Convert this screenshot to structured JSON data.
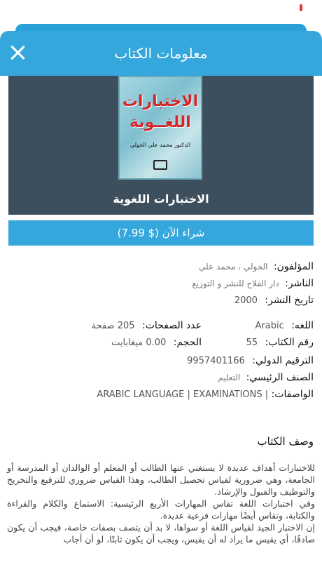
{
  "header": {
    "title": "معلومات الكتاب"
  },
  "book": {
    "cover_title_line1": "الاختبارات",
    "cover_title_line2": "اللغــوية",
    "cover_author": "الدكتور محمد علي الخولي",
    "title": "الاختبارات اللغوية"
  },
  "buy": {
    "label": "شراء الآن ($ 7.99)"
  },
  "meta": {
    "author_label": "المؤلفون:",
    "author_value": "الخولي ، محمد علي",
    "publisher_label": "الناشر:",
    "publisher_value": "دار الفلاح للنشر و التوزيع",
    "date_label": "تاريخ النشر:",
    "date_value": "2000",
    "pages_label": "عدد الصفحات:",
    "pages_value": "205 صفحة",
    "language_label": "اللغه:",
    "language_value": "Arabic",
    "size_label": "الحجم:",
    "size_value": "0.00 ميغابايت",
    "book_number_label": "رقم الكتاب:",
    "book_number_value": "55",
    "isbn_label": "الترقيم الدولي:",
    "isbn_value": "9957401166",
    "category_label": "الصنف الرئيسي:",
    "category_value": "التعليم",
    "tags_label": "الواصفات:",
    "tags_value": "ARABIC LANGUAGE | EXAMINATIONS |"
  },
  "description": {
    "title": "وصف الكتاب",
    "p1": "للاختبارات أهداف عديدة لا يستغني عنها الطالب أو المعلم أو الوالدان أو المدرسة أو الجامعة، وهي ضرورية لقياس تحصيل الطالب، وهذا القياس ضروري للترفيع والتخريج والتوظيف والقبول والإرشاد.",
    "p2": "وفي اختبارات اللغة تقاس المهارات الأربع الرئيسية: الاستماع والكلام والقراءة والكتابة، وتقاس أيضًا مهارات فرعية عديدة.",
    "p3": "إن الاختبار الجيد لقياس اللغة أو سواها، لا بد أن يتصف بصفات خاصة، فيجب أن يكون صادقًا، أي يقيس ما يراد له أن يقيس، ويجب أن يكون ثابتًا، لو أن أجاب"
  }
}
